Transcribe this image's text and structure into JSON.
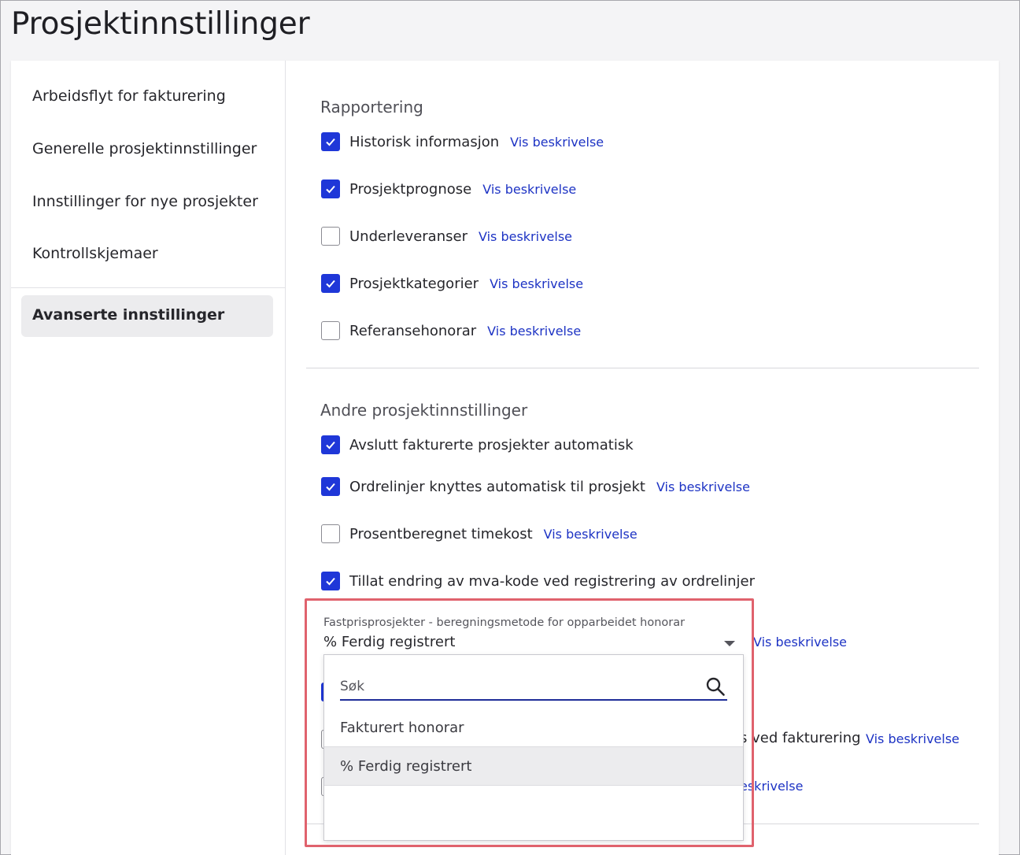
{
  "page": {
    "title": "Prosjektinnstillinger"
  },
  "sidebar": {
    "items": [
      {
        "label": "Arbeidsflyt for fakturering"
      },
      {
        "label": "Generelle prosjektinnstillinger"
      },
      {
        "label": "Innstillinger for nye prosjekter"
      },
      {
        "label": "Kontrollskjemaer"
      }
    ],
    "active": {
      "label": "Avanserte innstillinger"
    }
  },
  "reporting": {
    "title": "Rapportering",
    "items": [
      {
        "label": "Historisk informasjon",
        "checked": true,
        "link": "Vis beskrivelse"
      },
      {
        "label": "Prosjektprognose",
        "checked": true,
        "link": "Vis beskrivelse"
      },
      {
        "label": "Underleveranser",
        "checked": false,
        "link": "Vis beskrivelse"
      },
      {
        "label": "Prosjektkategorier",
        "checked": true,
        "link": "Vis beskrivelse"
      },
      {
        "label": "Referansehonorar",
        "checked": false,
        "link": "Vis beskrivelse"
      }
    ]
  },
  "other": {
    "title": "Andre prosjektinnstillinger",
    "items": [
      {
        "label": "Avslutt fakturerte prosjekter automatisk",
        "checked": true
      },
      {
        "label": "Ordrelinjer knyttes automatisk til prosjekt",
        "checked": true,
        "link": "Vis beskrivelse"
      },
      {
        "label": "Prosentberegnet timekost",
        "checked": false,
        "link": "Vis beskrivelse"
      },
      {
        "label": "Tillat endring av mva-kode ved registrering av ordrelinjer",
        "checked": true
      }
    ],
    "fixed_price": {
      "label": "Fastprisprosjekter - beregningsmetode for opparbeidet honorar",
      "value": "% Ferdig registrert",
      "link": "Vis beskrivelse"
    },
    "partial_rows": [
      {
        "visible_text": "s ved fakturering",
        "link": "Vis beskrivelse"
      },
      {
        "link_fragment": "eskrivelse"
      }
    ]
  },
  "dropdown": {
    "search_placeholder": "Søk",
    "options": [
      {
        "label": "Fakturert honorar",
        "selected": false
      },
      {
        "label": "% Ferdig registrert",
        "selected": true
      }
    ]
  },
  "colors": {
    "accent": "#1f37d8",
    "link": "#1d33c4",
    "highlight": "#e0626d"
  }
}
